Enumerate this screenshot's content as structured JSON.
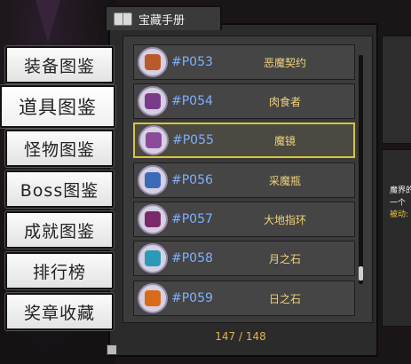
{
  "window": {
    "title": "宝藏手册"
  },
  "sidebar": {
    "items": [
      {
        "label": "装备图鉴",
        "active": false
      },
      {
        "label": "道具图鉴",
        "active": true
      },
      {
        "label": "怪物图鉴",
        "active": false
      },
      {
        "label": "Boss图鉴",
        "active": false
      },
      {
        "label": "成就图鉴",
        "active": false
      },
      {
        "label": "排行榜",
        "active": false
      },
      {
        "label": "奖章收藏",
        "active": false
      }
    ]
  },
  "list": {
    "items": [
      {
        "code": "#P053",
        "name": "恶魔契约",
        "icon": "demon-contract-icon",
        "color": "#b85a2a"
      },
      {
        "code": "#P054",
        "name": "肉食者",
        "icon": "carnivore-icon",
        "color": "#7a3c8a"
      },
      {
        "code": "#P055",
        "name": "魔镜",
        "icon": "magic-mirror-icon",
        "color": "#8a4c9a",
        "selected": true
      },
      {
        "code": "#P056",
        "name": "采魔瓶",
        "icon": "magic-bottle-icon",
        "color": "#3a6ab8"
      },
      {
        "code": "#P057",
        "name": "大地指环",
        "icon": "earth-ring-icon",
        "color": "#7a2a6a"
      },
      {
        "code": "#P058",
        "name": "月之石",
        "icon": "moonstone-icon",
        "color": "#2a9ab8"
      },
      {
        "code": "#P059",
        "name": "日之石",
        "icon": "sunstone-icon",
        "color": "#d86a1a"
      }
    ]
  },
  "counter": "147 / 148",
  "detail": {
    "line1": "魔界的",
    "line2": "一个",
    "line3": "被动:"
  }
}
